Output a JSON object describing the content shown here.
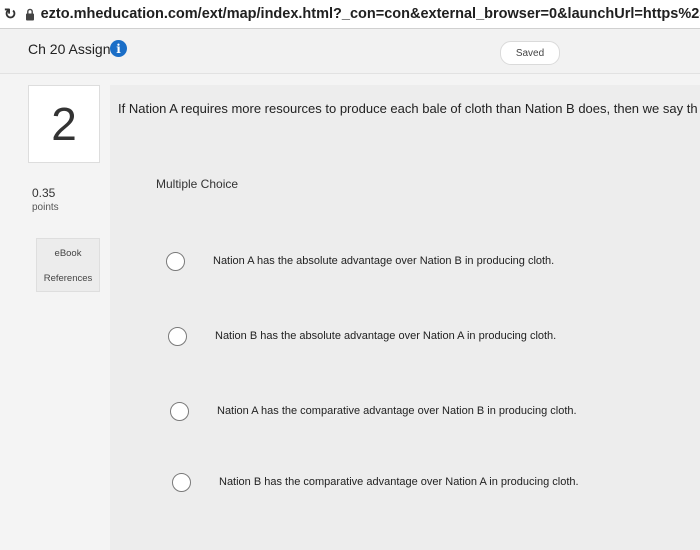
{
  "browser": {
    "url": "ezto.mheducation.com/ext/map/index.html?_con=con&external_browser=0&launchUrl=https%253A%252F%252Flm"
  },
  "header": {
    "title": "Ch 20 Assign",
    "status": "Saved",
    "colors": {
      "info_icon": "#1a6ec7"
    }
  },
  "question": {
    "number": "2",
    "points_value": "0.35",
    "points_label": "points",
    "resources": {
      "ebook": "eBook",
      "references": "References"
    },
    "text": "If Nation A requires more resources to produce each bale of cloth than Nation B does, then we say th",
    "type_label": "Multiple Choice",
    "options": [
      {
        "label": "Nation A has the absolute advantage over Nation B in producing cloth."
      },
      {
        "label": "Nation B has the absolute advantage over Nation A in producing cloth."
      },
      {
        "label": "Nation A has the comparative advantage over Nation B in producing cloth."
      },
      {
        "label": "Nation B has the comparative advantage over Nation A in producing cloth."
      }
    ]
  }
}
